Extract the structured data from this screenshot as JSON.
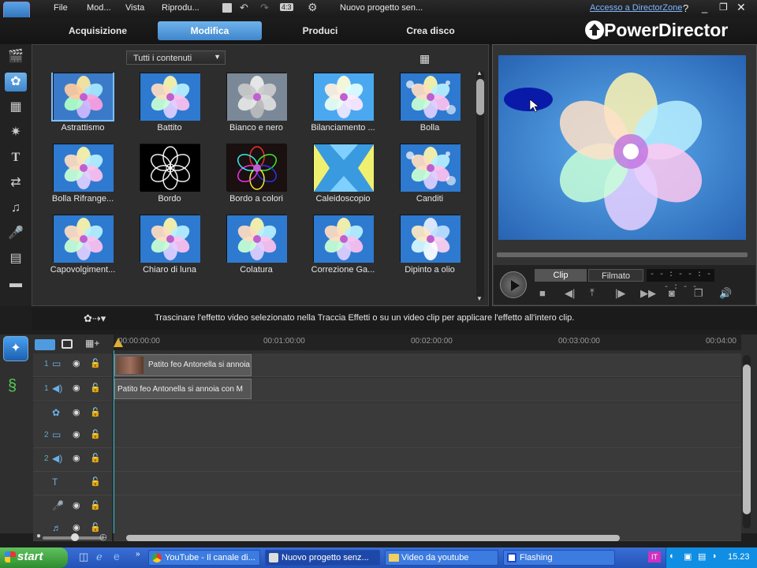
{
  "menu": {
    "items": [
      "File",
      "Mod...",
      "Vista",
      "Riprodu..."
    ],
    "project_title": "Nuovo progetto sen...",
    "ratio": "4:3",
    "directorzone_link": "Accesso a DirectorZone"
  },
  "tabs": [
    "Acquisizione",
    "Modifica",
    "Produci",
    "Crea disco"
  ],
  "active_tab": "Modifica",
  "brand": "PowerDirector",
  "library": {
    "filter_label": "Tutti i contenuti",
    "effects": [
      {
        "label": "Astrattismo",
        "style": "abstract",
        "selected": true
      },
      {
        "label": "Battito",
        "style": "normal"
      },
      {
        "label": "Bianco e nero",
        "style": "bw"
      },
      {
        "label": "Bilanciamento ...",
        "style": "bright"
      },
      {
        "label": "Bolla",
        "style": "bubble"
      },
      {
        "label": "Bolla Rifrange...",
        "style": "normal"
      },
      {
        "label": "Bordo",
        "style": "edge"
      },
      {
        "label": "Bordo a colori",
        "style": "coloredge"
      },
      {
        "label": "Caleidoscopio",
        "style": "kaleido"
      },
      {
        "label": "Canditi",
        "style": "bubble"
      },
      {
        "label": "Capovolgiment...",
        "style": "normal"
      },
      {
        "label": "Chiaro di luna",
        "style": "normal"
      },
      {
        "label": "Colatura",
        "style": "normal"
      },
      {
        "label": "Correzione Ga...",
        "style": "normal"
      },
      {
        "label": "Dipinto a olio",
        "style": "oil"
      }
    ]
  },
  "preview": {
    "clip_label": "Clip",
    "movie_label": "Filmato",
    "timecode": "- - : - - : - - : - -"
  },
  "hint": "Trascinare l'effetto video selezionato nella Traccia Effetti o su un video clip per applicare l'effetto all'intero clip.",
  "timeline": {
    "ruler": [
      "00:00:00:00",
      "00:01:00:00",
      "00:02:00:00",
      "00:03:00:00",
      "00:04:00"
    ],
    "tracks": [
      {
        "num": "1",
        "type": "video"
      },
      {
        "num": "1",
        "type": "audio"
      },
      {
        "num": "",
        "type": "fx"
      },
      {
        "num": "2",
        "type": "video"
      },
      {
        "num": "2",
        "type": "audio"
      },
      {
        "num": "",
        "type": "title"
      },
      {
        "num": "",
        "type": "voice"
      },
      {
        "num": "",
        "type": "music"
      }
    ],
    "clip_video": "Patito feo   Antonella si annoia",
    "clip_audio": "Patito feo   Antonella si annoia con M"
  },
  "taskbar": {
    "start": "start",
    "buttons": [
      {
        "label": "YouTube - Il canale di...",
        "active": false
      },
      {
        "label": "Nuovo progetto senz...",
        "active": true
      },
      {
        "label": "Video da youtube",
        "active": false
      },
      {
        "label": "Flashing",
        "active": false
      }
    ],
    "lang": "IT",
    "clock": "15.23"
  },
  "colors": {
    "accent": "#4f9be0",
    "preview_bg": "#2c6fb0",
    "taskbar": "#2a5bc5",
    "start": "#3fa53f"
  }
}
